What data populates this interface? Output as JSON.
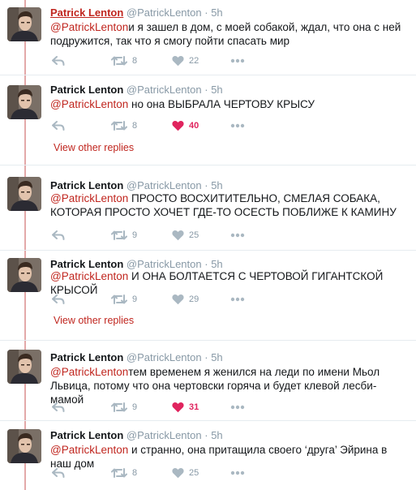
{
  "colors": {
    "accent": "#c0261f",
    "like": "#e0245e",
    "muted": "#8899a6",
    "thread_line": "#e3a9a9"
  },
  "icons": [
    "reply-icon",
    "retweet-icon",
    "heart-icon",
    "more-icon"
  ],
  "tweets": [
    {
      "name": "Patrick Lenton",
      "handle": "@PatrickLenton",
      "time": "5h",
      "mention": "@PatrickLenton",
      "text": "и я зашел в дом, с моей собакой, ждал, что  она с ней подружится, так что я смогу пойти спасать мир",
      "retweets": "8",
      "likes": "22",
      "liked": false,
      "name_highlight": true
    },
    {
      "name": "Patrick Lenton",
      "handle": "@PatrickLenton",
      "time": "5h",
      "mention": "@PatrickLenton",
      "text": " но она ВЫБРАЛА ЧЕРТОВУ КРЫСУ",
      "retweets": "8",
      "likes": "40",
      "liked": true
    },
    {
      "name": "Patrick Lenton",
      "handle": "@PatrickLenton",
      "time": "5h",
      "mention": "@PatrickLenton",
      "text": " ПРОСТО ВОСХИТИТЕЛЬНО, СМЕЛАЯ СОБАКА, КОТОРАЯ ПРОСТО ХОЧЕТ ГДЕ-ТО ОСЕСТЬ ПОБЛИЖЕ К КАМИНУ",
      "retweets": "9",
      "likes": "25",
      "liked": false
    },
    {
      "name": "Patrick Lenton",
      "handle": "@PatrickLenton",
      "time": "5h",
      "mention": "@PatrickLenton",
      "text": " И ОНА БОЛТАЕТСЯ С ЧЕРТОВОЙ ГИГАНТСКОЙ КРЫСОЙ",
      "retweets": "9",
      "likes": "29",
      "liked": false
    },
    {
      "name": "Patrick Lenton",
      "handle": "@PatrickLenton",
      "time": "5h",
      "mention": "@PatrickLenton",
      "text": "тем временем я женился на леди по имени Мьол Львица, потому что она чертовски горяча и будет клевой лесби-мамой",
      "retweets": "9",
      "likes": "31",
      "liked": true
    },
    {
      "name": "Patrick Lenton",
      "handle": "@PatrickLenton",
      "time": "5h",
      "mention": "@PatrickLenton",
      "text": " и странно, она притащила своего ‘друга’ Эйрина в наш дом",
      "retweets": "8",
      "likes": "25",
      "liked": false
    }
  ],
  "view_other_replies": [
    "View other replies",
    "View other replies"
  ]
}
